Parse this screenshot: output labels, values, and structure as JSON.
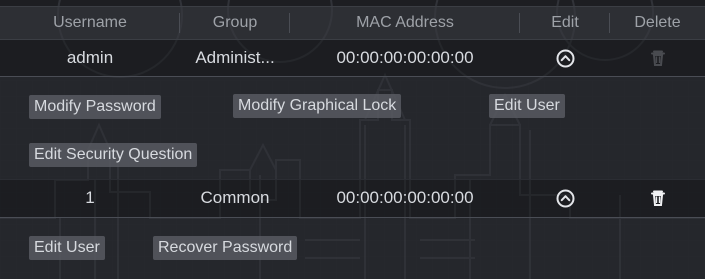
{
  "table": {
    "headers": {
      "username": "Username",
      "group": "Group",
      "mac_address": "MAC Address",
      "edit": "Edit",
      "delete": "Delete"
    },
    "rows": [
      {
        "username": "admin",
        "group": "Administ...",
        "mac_address": "00:00:00:00:00:00",
        "edit_icon": "chevron-up-circle-icon",
        "delete_icon": "trash-icon",
        "delete_enabled": false,
        "actions": [
          "Modify Password",
          "Modify Graphical Lock",
          "Edit User",
          "Edit Security Question"
        ]
      },
      {
        "username": "1",
        "group": "Common",
        "mac_address": "00:00:00:00:00:00",
        "edit_icon": "chevron-up-circle-icon",
        "delete_icon": "trash-icon",
        "delete_enabled": true,
        "actions": [
          "Edit User",
          "Recover Password"
        ]
      }
    ]
  },
  "colors": {
    "background": "#1d1e22",
    "header_text": "#9ea2a8",
    "text": "#d8dbe0",
    "button_bg": "#585b62",
    "disabled_icon": "#6b6e74"
  }
}
